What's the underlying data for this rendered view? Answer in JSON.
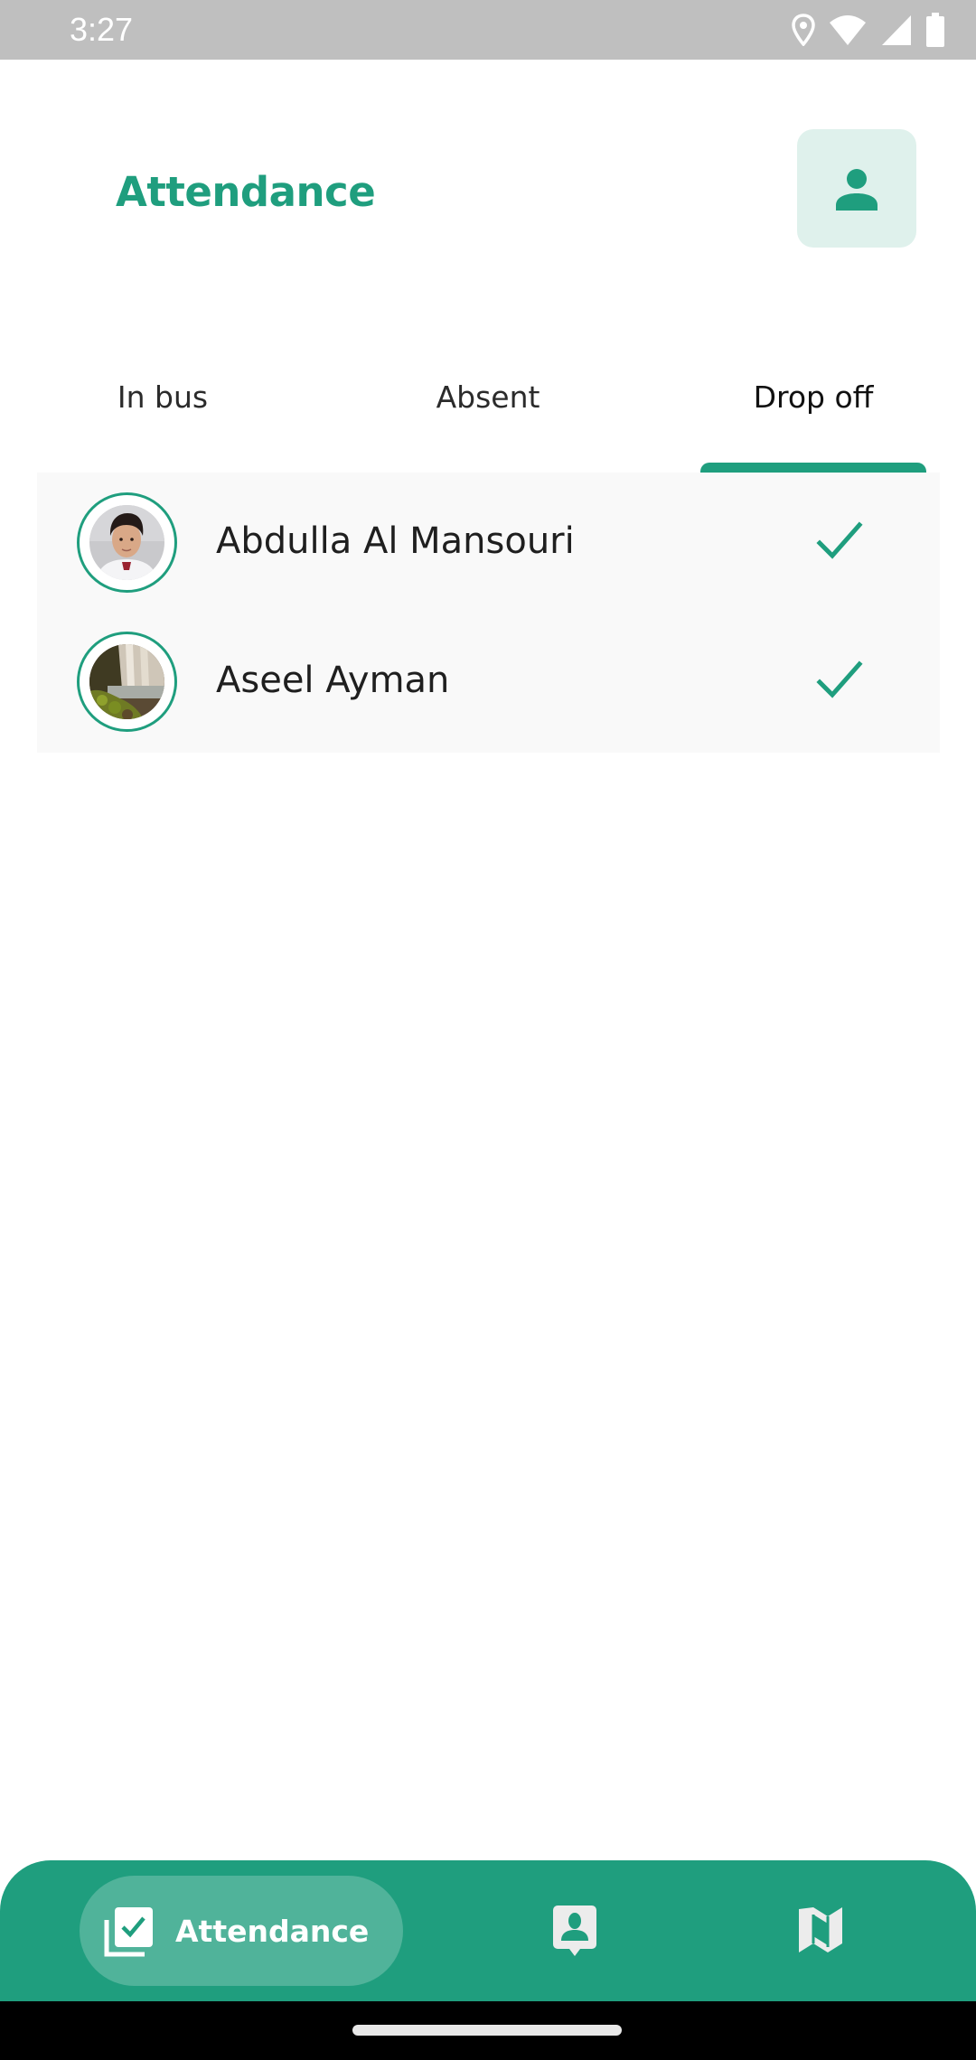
{
  "status_bar": {
    "time": "3:27",
    "icons": [
      "location-icon",
      "wifi-icon",
      "signal-icon",
      "battery-icon"
    ]
  },
  "header": {
    "title": "Attendance",
    "profile_button_icon": "person-icon"
  },
  "tabs": {
    "items": [
      {
        "label": "In bus",
        "active": false
      },
      {
        "label": "Absent",
        "active": false
      },
      {
        "label": "Drop off",
        "active": true
      }
    ]
  },
  "students": [
    {
      "name": "Abdulla Al Mansouri",
      "avatar": "student-photo",
      "status_icon": "check-icon",
      "checked": true
    },
    {
      "name": "Aseel Ayman",
      "avatar": "waterfall-photo",
      "status_icon": "check-icon",
      "checked": true
    }
  ],
  "bottom_nav": {
    "items": [
      {
        "label": "Attendance",
        "icon": "attendance-check-icon",
        "active": true
      },
      {
        "label": "",
        "icon": "contact-pin-icon",
        "active": false
      },
      {
        "label": "",
        "icon": "map-icon",
        "active": false
      }
    ]
  },
  "colors": {
    "accent": "#1f9e7e",
    "accent_light": "#dff1ec",
    "list_background": "#f9f9f9",
    "status_bar": "#bfbfbf"
  }
}
